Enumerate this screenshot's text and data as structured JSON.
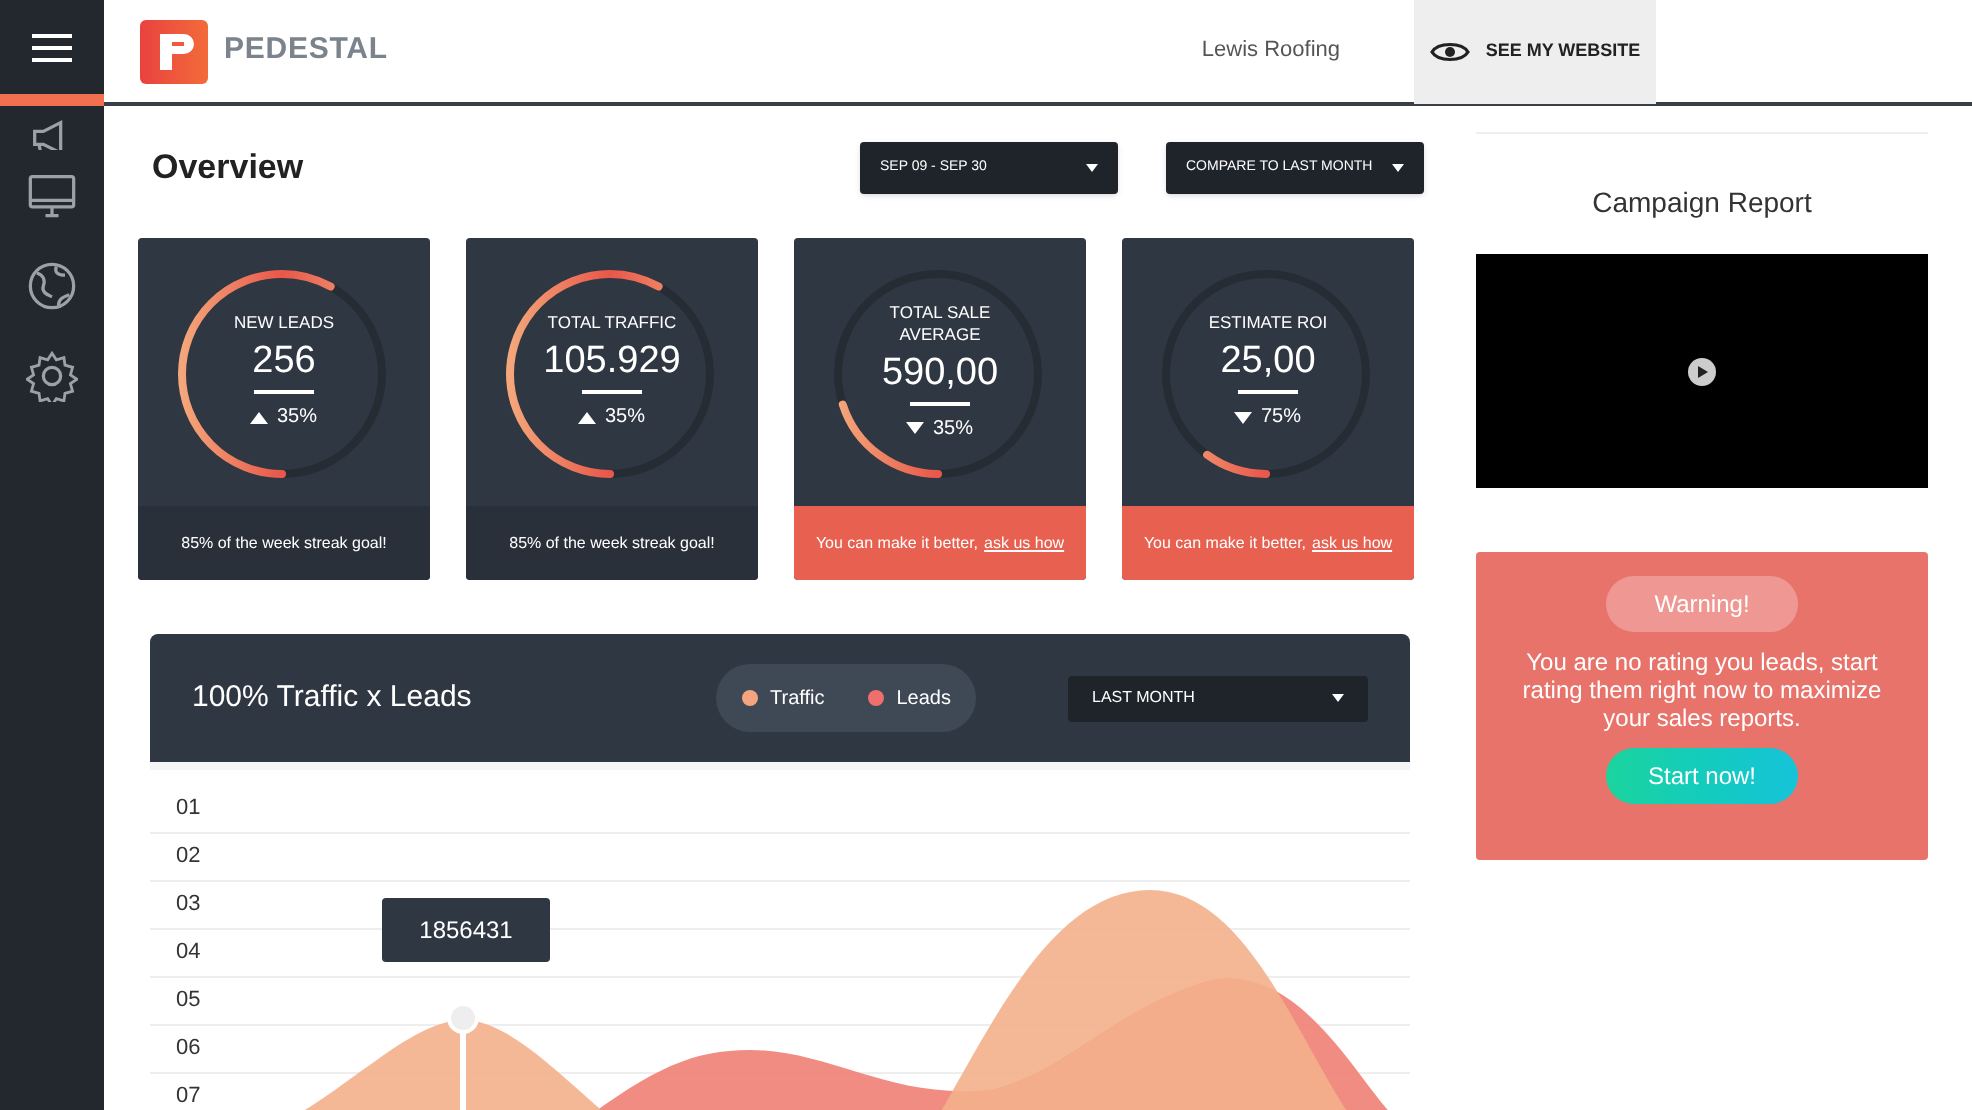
{
  "sidebar": {
    "items": [
      {
        "kind": "megaphone",
        "selected": true
      },
      {
        "kind": "monitor",
        "selected": false
      },
      {
        "kind": "globe",
        "selected": false
      },
      {
        "kind": "gear",
        "selected": false
      }
    ]
  },
  "header": {
    "brand": "PEDESTAL",
    "account": "Lewis Roofing",
    "website_button": "SEE MY WEBSITE"
  },
  "page_title": "Overview",
  "filters": [
    {
      "label": "SEP 09 - SEP 30"
    },
    {
      "label": "COMPARE TO LAST MONTH"
    }
  ],
  "stats": [
    {
      "title": "NEW LEADS",
      "value": "256",
      "increase": true,
      "change": "35%",
      "level": 0.58,
      "footer": {
        "kind": "goal",
        "text": "85% of the week streak goal!"
      }
    },
    {
      "title": "TOTAL TRAFFIC",
      "value": "105.929",
      "increase": true,
      "change": "35%",
      "level": 0.58,
      "footer": {
        "kind": "goal",
        "text": "85% of the week streak goal!"
      }
    },
    {
      "title": "TOTAL SALE AVERAGE",
      "value": "590,00",
      "increase": false,
      "change": "35%",
      "level": 0.2,
      "footer": {
        "kind": "tip",
        "text": "You can make it better, ",
        "link": "ask us how"
      }
    },
    {
      "title": "ESTIMATE ROI",
      "value": "25,00",
      "increase": false,
      "change": "75%",
      "level": 0.1,
      "footer": {
        "kind": "tip",
        "text": "You can make it better, ",
        "link": "ask us how"
      }
    }
  ],
  "traffic_panel": {
    "title": "100% Traffic x Leads",
    "legend": [
      {
        "label": "Traffic",
        "color": "#f4a57f"
      },
      {
        "label": "Leads",
        "color": "#ef6f6c"
      }
    ],
    "period": "LAST MONTH",
    "y_labels": [
      "01",
      "02",
      "03",
      "04",
      "05",
      "06",
      "07"
    ],
    "tooltip": "1856431"
  },
  "campaign": {
    "title": "Campaign Report"
  },
  "warning": {
    "badge": "Warning!",
    "message": "You are no rating you leads, start rating them right now to maximize your sales reports.",
    "button": "Start now!"
  }
}
